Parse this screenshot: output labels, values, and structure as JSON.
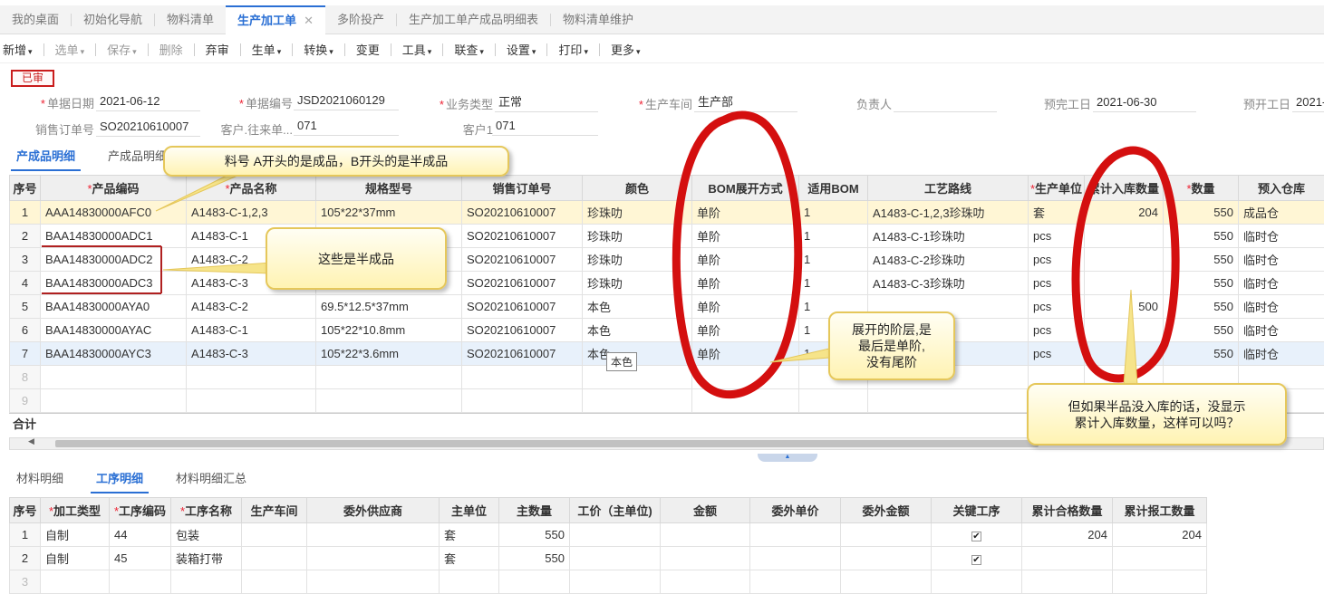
{
  "tabs": [
    {
      "label": "我的桌面"
    },
    {
      "label": "初始化导航"
    },
    {
      "label": "物料清单"
    },
    {
      "label": "生产加工单",
      "close": "✕"
    },
    {
      "label": "多阶投产"
    },
    {
      "label": "生产加工单产成品明细表"
    },
    {
      "label": "物料清单维护"
    }
  ],
  "toolbar": {
    "new": "新增",
    "select": "选单",
    "save": "保存",
    "delete": "删除",
    "abandon": "弃审",
    "gen": "生单",
    "convert": "转换",
    "change": "变更",
    "tools": "工具",
    "query": "联查",
    "settings": "设置",
    "print": "打印",
    "more": "更多",
    "caret": "▾"
  },
  "status": "已审",
  "form": {
    "doc_date_label": "单据日期",
    "doc_date": "2021-06-12",
    "doc_no_label": "单据编号",
    "doc_no": "JSD2021060129",
    "biz_type_label": "业务类型",
    "biz_type": "正常",
    "workshop_label": "生产车间",
    "workshop": "生产部",
    "owner_label": "负责人",
    "owner": "",
    "finish_label": "预完工日",
    "finish": "2021-06-30",
    "start_label": "预开工日",
    "start": "2021-",
    "so_label": "销售订单号",
    "so": "SO20210610007",
    "cust_contact_label": "客户.往来单...",
    "cust_contact": "071",
    "cust_label": "客户1",
    "cust": "071",
    "required_mark": "*"
  },
  "subtabs_top": [
    "产成品明细",
    "产成品明细"
  ],
  "product_table": {
    "headers": [
      "序号",
      "产品编码",
      "产品名称",
      "规格型号",
      "销售订单号",
      "颜色",
      "BOM展开方式",
      "适用BOM",
      "工艺路线",
      "生产单位",
      "累计入库数量",
      "数量",
      "预入仓库"
    ],
    "rows": [
      [
        "1",
        "AAA14830000AFC0",
        "A1483-C-1,2,3",
        "105*22*37mm",
        "SO20210610007",
        "珍珠叻",
        "单阶",
        "1",
        "A1483-C-1,2,3珍珠叻",
        "套",
        "204",
        "550",
        "成品仓"
      ],
      [
        "2",
        "BAA14830000ADC1",
        "A1483-C-1",
        "",
        "SO20210610007",
        "珍珠叻",
        "单阶",
        "1",
        "A1483-C-1珍珠叻",
        "pcs",
        "",
        "550",
        "临时仓"
      ],
      [
        "3",
        "BAA14830000ADC2",
        "A1483-C-2",
        "",
        "SO20210610007",
        "珍珠叻",
        "单阶",
        "1",
        "A1483-C-2珍珠叻",
        "pcs",
        "",
        "550",
        "临时仓"
      ],
      [
        "4",
        "BAA14830000ADC3",
        "A1483-C-3",
        "",
        "SO20210610007",
        "珍珠叻",
        "单阶",
        "1",
        "A1483-C-3珍珠叻",
        "pcs",
        "",
        "550",
        "临时仓"
      ],
      [
        "5",
        "BAA14830000AYA0",
        "A1483-C-2",
        "69.5*12.5*37mm",
        "SO20210610007",
        "本色",
        "单阶",
        "1",
        "",
        "pcs",
        "500",
        "550",
        "临时仓"
      ],
      [
        "6",
        "BAA14830000AYAC",
        "A1483-C-1",
        "105*22*10.8mm",
        "SO20210610007",
        "本色",
        "单阶",
        "1",
        "",
        "pcs",
        "",
        "550",
        "临时仓"
      ],
      [
        "7",
        "BAA14830000AYC3",
        "A1483-C-3",
        "105*22*3.6mm",
        "SO20210610007",
        "本色",
        "单阶",
        "1",
        "",
        "pcs",
        "",
        "550",
        "临时仓"
      ],
      [
        "8"
      ],
      [
        "9"
      ]
    ],
    "total_label": "合计",
    "tooltip": "本色"
  },
  "subtabs_bottom": [
    "材料明细",
    "工序明细",
    "材料明细汇总"
  ],
  "process_table": {
    "headers": [
      "序号",
      "加工类型",
      "工序编码",
      "工序名称",
      "生产车间",
      "委外供应商",
      "主单位",
      "主数量",
      "工价（主单位)",
      "金额",
      "委外单价",
      "委外金额",
      "关键工序",
      "累计合格数量",
      "累计报工数量"
    ],
    "rows": [
      [
        "1",
        "自制",
        "44",
        "包装",
        "",
        "",
        "套",
        "550",
        "",
        "",
        "",
        "",
        "✔",
        "204",
        "204"
      ],
      [
        "2",
        "自制",
        "45",
        "装箱打带",
        "",
        "",
        "套",
        "550",
        "",
        "",
        "",
        "",
        "✔",
        "",
        ""
      ],
      [
        "3"
      ]
    ]
  },
  "callouts": {
    "item_prefix": "料号 A开头的是成品，B开头的是半成品",
    "semi": "这些是半成品",
    "levels_1": "展开的阶层,是",
    "levels_2": "最后是单阶,",
    "levels_3": "没有尾阶",
    "question_1": "但如果半品没入库的话，没显示",
    "question_2": "累计入库数量，这样可以吗？"
  },
  "colors": {
    "accent": "#2a6fd4",
    "stamp": "#c91c1c",
    "annotation_red": "#d40f0f",
    "callout_fill": "#fff3b3"
  }
}
